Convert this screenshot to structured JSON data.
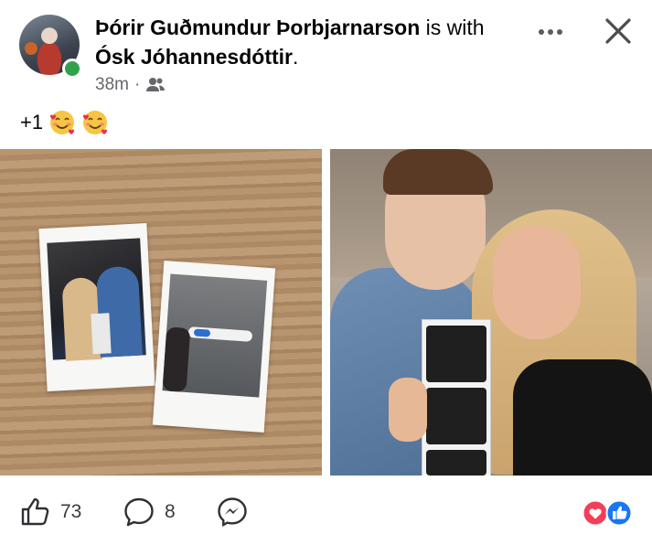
{
  "post": {
    "author": "Þórir Guðmundur Þorbjarnarson",
    "with_prefix": "is",
    "with_word": "with",
    "tagged": "Ósk Jóhannesdóttir",
    "time": "38m",
    "separator": "·",
    "audience_icon": "friends-icon",
    "text": "+1",
    "emojis": [
      "smiling-face-with-hearts",
      "smiling-face-with-hearts"
    ]
  },
  "engagement": {
    "likes": "73",
    "comments": "8",
    "icons": [
      "like-icon",
      "comment-icon",
      "messenger-icon"
    ],
    "reaction_icons": [
      "love-reaction-icon",
      "like-reaction-icon"
    ]
  },
  "colors": {
    "online": "#31a24c",
    "love": "#f33e58",
    "like": "#1877f2",
    "secondary_text": "#65676b"
  }
}
